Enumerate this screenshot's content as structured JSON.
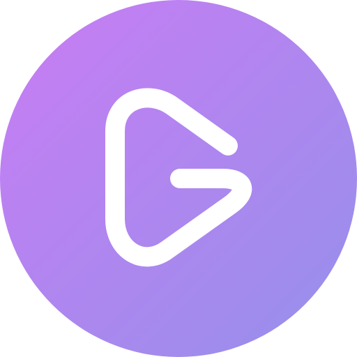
{
  "icon": {
    "name": "play-g-logo",
    "gradient": {
      "start": "#c97cf4",
      "end": "#9590ea"
    },
    "glyph_color": "#ffffff"
  }
}
